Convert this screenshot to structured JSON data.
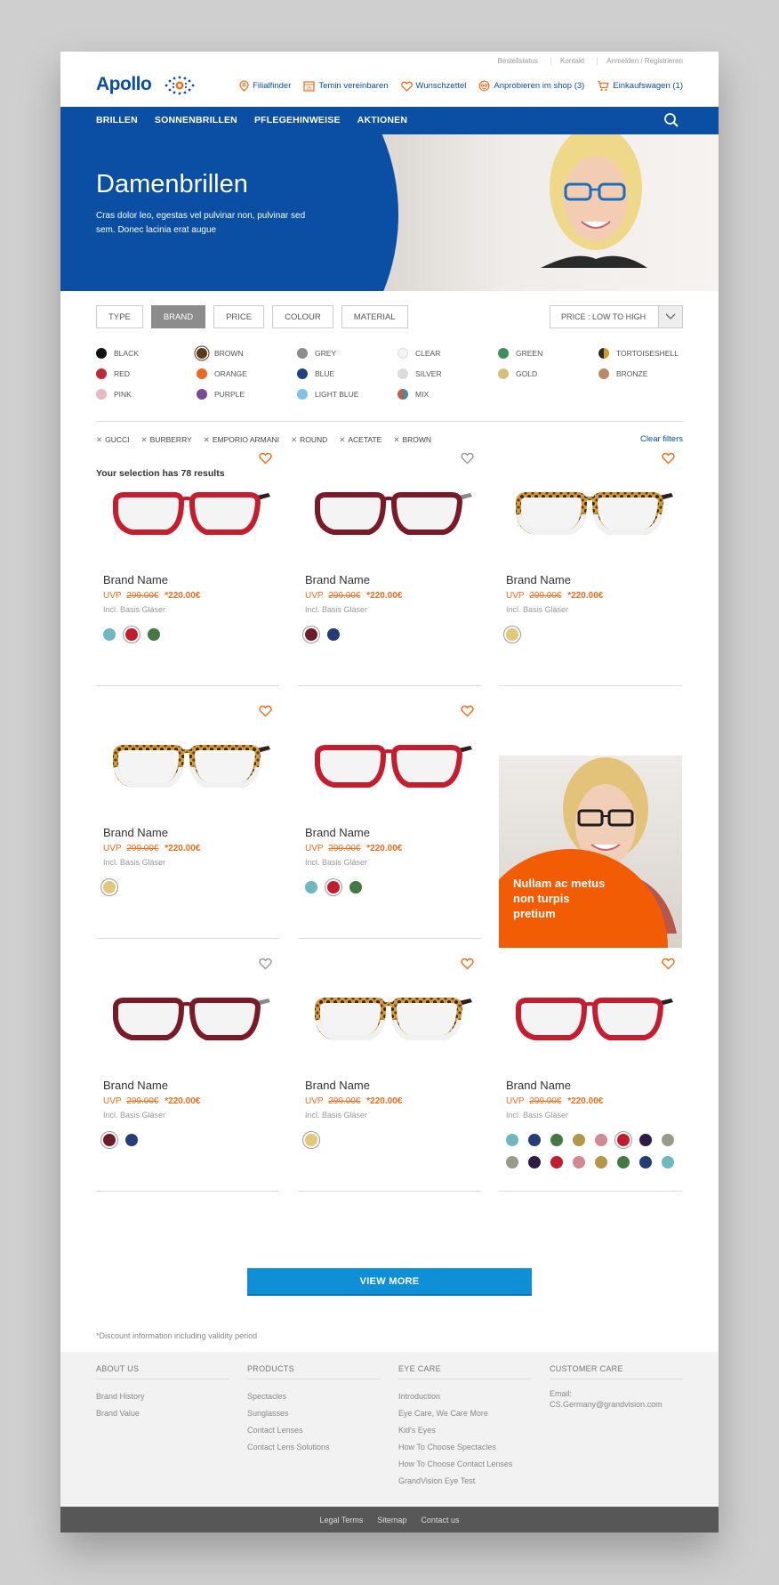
{
  "header": {
    "util_links": [
      "Bestellstatus",
      "Kontakt",
      "Anmelden / Registrieren"
    ],
    "logo": "Apollo",
    "top_nav": [
      {
        "icon": "location-pin-icon",
        "label": "Filialfinder"
      },
      {
        "icon": "calendar-icon",
        "label": "Temin vereinbaren"
      },
      {
        "icon": "heart-icon",
        "label": "Wunschzettel"
      },
      {
        "icon": "face-icon",
        "label": "Anprobieren im shop (3)"
      },
      {
        "icon": "cart-icon",
        "label": "Einkaufswagen (1)"
      }
    ],
    "main_nav": [
      "BRILLEN",
      "SONNENBRILLEN",
      "PFLEGEHINWEISE",
      "AKTIONEN"
    ]
  },
  "hero": {
    "title": "Damenbrillen",
    "text": "Cras dolor leo, egestas vel pulvinar non, pulvinar sed sem. Donec lacinia erat augue"
  },
  "filters": {
    "buttons": [
      "TYPE",
      "BRAND",
      "PRICE",
      "COLOUR",
      "MATERIAL"
    ],
    "active": "BRAND",
    "sort": "PRICE : LOW TO HIGH",
    "colors": [
      {
        "label": "BLACK",
        "hex": "#111111"
      },
      {
        "label": "BROWN",
        "hex": "#5a3a1a"
      },
      {
        "label": "GREY",
        "hex": "#8c8c8c"
      },
      {
        "label": "CLEAR",
        "hex": "#f4f4f4"
      },
      {
        "label": "GREEN",
        "hex": "#3f8f5a"
      },
      {
        "label": "TORTOISESHELL",
        "hex": "#c48a1c"
      },
      {
        "label": "RED",
        "hex": "#c0283a"
      },
      {
        "label": "ORANGE",
        "hex": "#ea6a23"
      },
      {
        "label": "BLUE",
        "hex": "#1f3f88"
      },
      {
        "label": "SILVER",
        "hex": "#dcdcdc"
      },
      {
        "label": "GOLD",
        "hex": "#d8c27b"
      },
      {
        "label": "BRONZE",
        "hex": "#b88b66"
      },
      {
        "label": "PINK",
        "hex": "#e7b9c2"
      },
      {
        "label": "PURPLE",
        "hex": "#7a4b95"
      },
      {
        "label": "LIGHT BLUE",
        "hex": "#7fc3e6"
      },
      {
        "label": "MIX",
        "hex": "#c55a4a"
      }
    ],
    "applied": [
      "GUCCI",
      "BURBERRY",
      "EMPORIO ARMANI",
      "ROUND",
      "ACETATE",
      "BROWN"
    ],
    "clear_label": "Clear filters"
  },
  "results_text": "Your selection has 78 results",
  "products": [
    {
      "brand": "Brand Name",
      "uvp": "UVP",
      "old_price": "299.00€",
      "new_price": "*220.00€",
      "incl": "Incl. Basis Gläser",
      "style": "red",
      "fav": true,
      "swatches": [
        "#6fb8c0",
        "#c11d2f",
        "#437a44"
      ],
      "selected": 1
    },
    {
      "brand": "Brand Name",
      "uvp": "UVP",
      "old_price": "299.00€",
      "new_price": "*220.00€",
      "incl": "Incl. Basis Gläser",
      "style": "burgundy",
      "fav": false,
      "swatches": [
        "#6b1e28",
        "#263c78"
      ],
      "selected": 0
    },
    {
      "brand": "Brand Name",
      "uvp": "UVP",
      "old_price": "299.00€",
      "new_price": "*220.00€",
      "incl": "Incl. Basis Gläser",
      "style": "tortoise",
      "fav": true,
      "swatches": [
        "#e3c87a"
      ],
      "selected": 0
    },
    {
      "brand": "Brand Name",
      "uvp": "UVP",
      "old_price": "299.00€",
      "new_price": "*220.00€",
      "incl": "Incl. Basis Gläser",
      "style": "tortoise",
      "fav": true,
      "swatches": [
        "#e3c87a"
      ],
      "selected": 0
    },
    {
      "brand": "Brand Name",
      "uvp": "UVP",
      "old_price": "299.00€",
      "new_price": "*220.00€",
      "incl": "Incl. Basis Gläser",
      "style": "red",
      "fav": true,
      "swatches": [
        "#6fb8c0",
        "#c11d2f",
        "#437a44"
      ],
      "selected": 1
    },
    {
      "brand": "Brand Name",
      "uvp": "UVP",
      "old_price": "299.00€",
      "new_price": "*220.00€",
      "incl": "Incl. Basis Gläser",
      "style": "burgundy",
      "fav": false,
      "swatches": [
        "#6b1e28",
        "#263c78"
      ],
      "selected": 0
    },
    {
      "brand": "Brand Name",
      "uvp": "UVP",
      "old_price": "299.00€",
      "new_price": "*220.00€",
      "incl": "Incl. Basis Gläser",
      "style": "tortoise",
      "fav": true,
      "swatches": [
        "#e3c87a"
      ],
      "selected": 0
    },
    {
      "brand": "Brand Name",
      "uvp": "UVP",
      "old_price": "299.00€",
      "new_price": "*220.00€",
      "incl": "Incl. Basis Gläser",
      "style": "red",
      "fav": true,
      "swatches": [
        "#6fb8c0",
        "#263c78",
        "#437a44",
        "#b5974b",
        "#cf8a93",
        "#c11d2f",
        "#2d1a45",
        "#9a9a8a",
        "#9a9a8a",
        "#2d1a45",
        "#c11d2f",
        "#cf8a93",
        "#b5974b",
        "#437a44",
        "#263c78",
        "#6fb8c0"
      ],
      "selected": 5
    }
  ],
  "promo_text": "Nullam ac metus non turpis pretium",
  "view_more": "VIEW MORE",
  "discount_note": "*Discount information including validity period",
  "footer": {
    "columns": [
      {
        "title": "ABOUT US",
        "links": [
          "Brand History",
          "Brand Value"
        ]
      },
      {
        "title": "PRODUCTS",
        "links": [
          "Spectacles",
          "Sunglasses",
          "Contact Lenses",
          "Contact Lens Solutions"
        ]
      },
      {
        "title": "EYE CARE",
        "links": [
          "Introduction",
          "Eye Care, We Care More",
          "Kid's Eyes",
          "How To Choose Spectacles",
          "How To Choose Contact Lenses",
          "GrandVision Eye Test"
        ]
      },
      {
        "title": "CUSTOMER CARE",
        "links": [
          "Email:",
          "CS.Germany@grandvision.com"
        ]
      }
    ],
    "bottom_links": [
      "Legal Terms",
      "Sitemap",
      "Contact us"
    ]
  }
}
